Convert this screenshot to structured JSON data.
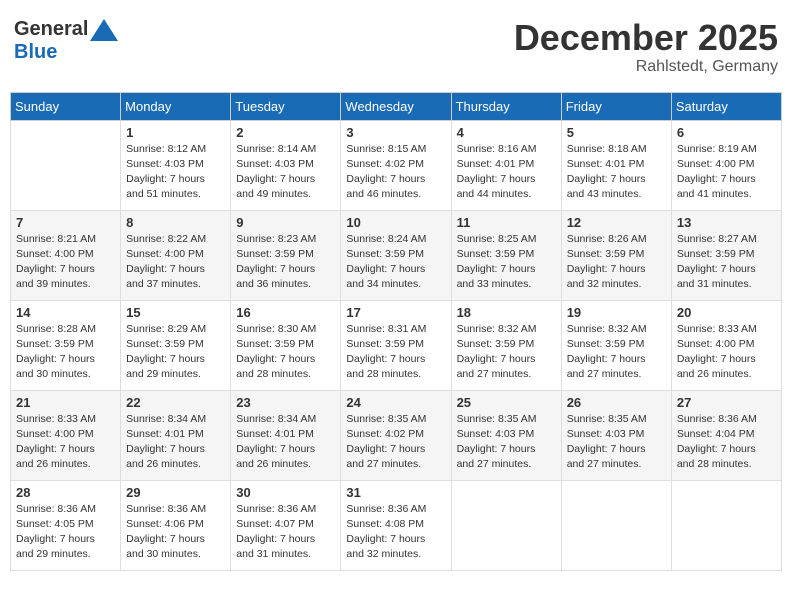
{
  "header": {
    "logo": {
      "general": "General",
      "blue": "Blue"
    },
    "title": "December 2025",
    "location": "Rahlstedt, Germany"
  },
  "columns": [
    "Sunday",
    "Monday",
    "Tuesday",
    "Wednesday",
    "Thursday",
    "Friday",
    "Saturday"
  ],
  "weeks": [
    [
      {
        "day": "",
        "sunrise": "",
        "sunset": "",
        "daylight": ""
      },
      {
        "day": "1",
        "sunrise": "Sunrise: 8:12 AM",
        "sunset": "Sunset: 4:03 PM",
        "daylight": "Daylight: 7 hours and 51 minutes."
      },
      {
        "day": "2",
        "sunrise": "Sunrise: 8:14 AM",
        "sunset": "Sunset: 4:03 PM",
        "daylight": "Daylight: 7 hours and 49 minutes."
      },
      {
        "day": "3",
        "sunrise": "Sunrise: 8:15 AM",
        "sunset": "Sunset: 4:02 PM",
        "daylight": "Daylight: 7 hours and 46 minutes."
      },
      {
        "day": "4",
        "sunrise": "Sunrise: 8:16 AM",
        "sunset": "Sunset: 4:01 PM",
        "daylight": "Daylight: 7 hours and 44 minutes."
      },
      {
        "day": "5",
        "sunrise": "Sunrise: 8:18 AM",
        "sunset": "Sunset: 4:01 PM",
        "daylight": "Daylight: 7 hours and 43 minutes."
      },
      {
        "day": "6",
        "sunrise": "Sunrise: 8:19 AM",
        "sunset": "Sunset: 4:00 PM",
        "daylight": "Daylight: 7 hours and 41 minutes."
      }
    ],
    [
      {
        "day": "7",
        "sunrise": "Sunrise: 8:21 AM",
        "sunset": "Sunset: 4:00 PM",
        "daylight": "Daylight: 7 hours and 39 minutes."
      },
      {
        "day": "8",
        "sunrise": "Sunrise: 8:22 AM",
        "sunset": "Sunset: 4:00 PM",
        "daylight": "Daylight: 7 hours and 37 minutes."
      },
      {
        "day": "9",
        "sunrise": "Sunrise: 8:23 AM",
        "sunset": "Sunset: 3:59 PM",
        "daylight": "Daylight: 7 hours and 36 minutes."
      },
      {
        "day": "10",
        "sunrise": "Sunrise: 8:24 AM",
        "sunset": "Sunset: 3:59 PM",
        "daylight": "Daylight: 7 hours and 34 minutes."
      },
      {
        "day": "11",
        "sunrise": "Sunrise: 8:25 AM",
        "sunset": "Sunset: 3:59 PM",
        "daylight": "Daylight: 7 hours and 33 minutes."
      },
      {
        "day": "12",
        "sunrise": "Sunrise: 8:26 AM",
        "sunset": "Sunset: 3:59 PM",
        "daylight": "Daylight: 7 hours and 32 minutes."
      },
      {
        "day": "13",
        "sunrise": "Sunrise: 8:27 AM",
        "sunset": "Sunset: 3:59 PM",
        "daylight": "Daylight: 7 hours and 31 minutes."
      }
    ],
    [
      {
        "day": "14",
        "sunrise": "Sunrise: 8:28 AM",
        "sunset": "Sunset: 3:59 PM",
        "daylight": "Daylight: 7 hours and 30 minutes."
      },
      {
        "day": "15",
        "sunrise": "Sunrise: 8:29 AM",
        "sunset": "Sunset: 3:59 PM",
        "daylight": "Daylight: 7 hours and 29 minutes."
      },
      {
        "day": "16",
        "sunrise": "Sunrise: 8:30 AM",
        "sunset": "Sunset: 3:59 PM",
        "daylight": "Daylight: 7 hours and 28 minutes."
      },
      {
        "day": "17",
        "sunrise": "Sunrise: 8:31 AM",
        "sunset": "Sunset: 3:59 PM",
        "daylight": "Daylight: 7 hours and 28 minutes."
      },
      {
        "day": "18",
        "sunrise": "Sunrise: 8:32 AM",
        "sunset": "Sunset: 3:59 PM",
        "daylight": "Daylight: 7 hours and 27 minutes."
      },
      {
        "day": "19",
        "sunrise": "Sunrise: 8:32 AM",
        "sunset": "Sunset: 3:59 PM",
        "daylight": "Daylight: 7 hours and 27 minutes."
      },
      {
        "day": "20",
        "sunrise": "Sunrise: 8:33 AM",
        "sunset": "Sunset: 4:00 PM",
        "daylight": "Daylight: 7 hours and 26 minutes."
      }
    ],
    [
      {
        "day": "21",
        "sunrise": "Sunrise: 8:33 AM",
        "sunset": "Sunset: 4:00 PM",
        "daylight": "Daylight: 7 hours and 26 minutes."
      },
      {
        "day": "22",
        "sunrise": "Sunrise: 8:34 AM",
        "sunset": "Sunset: 4:01 PM",
        "daylight": "Daylight: 7 hours and 26 minutes."
      },
      {
        "day": "23",
        "sunrise": "Sunrise: 8:34 AM",
        "sunset": "Sunset: 4:01 PM",
        "daylight": "Daylight: 7 hours and 26 minutes."
      },
      {
        "day": "24",
        "sunrise": "Sunrise: 8:35 AM",
        "sunset": "Sunset: 4:02 PM",
        "daylight": "Daylight: 7 hours and 27 minutes."
      },
      {
        "day": "25",
        "sunrise": "Sunrise: 8:35 AM",
        "sunset": "Sunset: 4:03 PM",
        "daylight": "Daylight: 7 hours and 27 minutes."
      },
      {
        "day": "26",
        "sunrise": "Sunrise: 8:35 AM",
        "sunset": "Sunset: 4:03 PM",
        "daylight": "Daylight: 7 hours and 27 minutes."
      },
      {
        "day": "27",
        "sunrise": "Sunrise: 8:36 AM",
        "sunset": "Sunset: 4:04 PM",
        "daylight": "Daylight: 7 hours and 28 minutes."
      }
    ],
    [
      {
        "day": "28",
        "sunrise": "Sunrise: 8:36 AM",
        "sunset": "Sunset: 4:05 PM",
        "daylight": "Daylight: 7 hours and 29 minutes."
      },
      {
        "day": "29",
        "sunrise": "Sunrise: 8:36 AM",
        "sunset": "Sunset: 4:06 PM",
        "daylight": "Daylight: 7 hours and 30 minutes."
      },
      {
        "day": "30",
        "sunrise": "Sunrise: 8:36 AM",
        "sunset": "Sunset: 4:07 PM",
        "daylight": "Daylight: 7 hours and 31 minutes."
      },
      {
        "day": "31",
        "sunrise": "Sunrise: 8:36 AM",
        "sunset": "Sunset: 4:08 PM",
        "daylight": "Daylight: 7 hours and 32 minutes."
      },
      {
        "day": "",
        "sunrise": "",
        "sunset": "",
        "daylight": ""
      },
      {
        "day": "",
        "sunrise": "",
        "sunset": "",
        "daylight": ""
      },
      {
        "day": "",
        "sunrise": "",
        "sunset": "",
        "daylight": ""
      }
    ]
  ]
}
